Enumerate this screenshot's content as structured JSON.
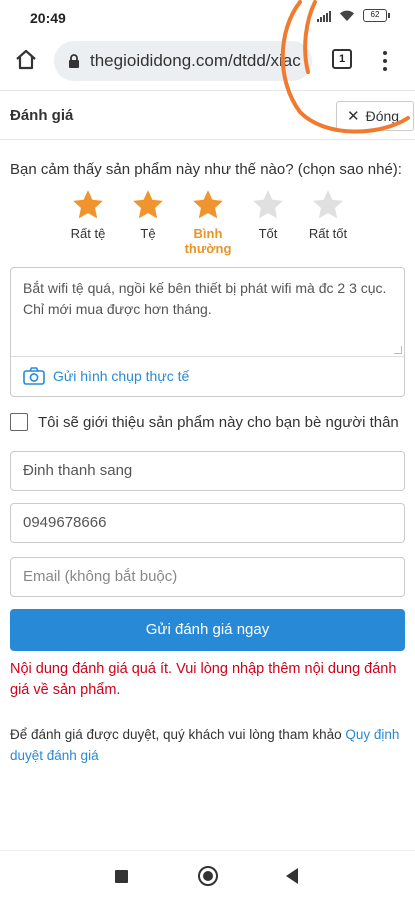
{
  "status": {
    "time": "20:49",
    "battery": "62"
  },
  "browser": {
    "url": "thegioididong.com/dtdd/xiac",
    "tab_count": "1"
  },
  "header": {
    "title": "Đánh giá",
    "close_label": "Đóng"
  },
  "rating": {
    "question": "Bạn cảm thấy sản phẩm này như thế nào? (chọn sao nhé):",
    "selected": 3,
    "star_color_active": "#f0952d",
    "star_color_inactive": "#e0e0e0",
    "options": [
      {
        "label": "Rất tệ"
      },
      {
        "label": "Tệ"
      },
      {
        "label": "Bình thường"
      },
      {
        "label": "Tốt"
      },
      {
        "label": "Rất tốt"
      }
    ]
  },
  "review": {
    "text": "Bắt wifi tệ quá, ngồi kế bên thiết bị phát wifi mà đc 2 3 cục. Chỉ mới mua được hơn tháng.",
    "photo_label": "Gửi hình chụp thực tế"
  },
  "recommend": {
    "label": "Tôi sẽ giới thiệu sản phẩm này cho bạn bè người thân",
    "checked": false
  },
  "form": {
    "name": "Đinh thanh sang",
    "phone": "0949678666",
    "email_placeholder": "Email (không bắt buộc)"
  },
  "submit_label": "Gửi đánh giá ngay",
  "error_message": "Nội dung đánh giá quá ít. Vui lòng nhập thêm nội dung đánh giá về sản phẩm.",
  "note": {
    "text": "Để đánh giá được duyệt, quý khách vui lòng tham khảo ",
    "link": "Quy định duyệt đánh giá"
  },
  "colors": {
    "accent": "#288ad6",
    "error": "#d0021b",
    "annotation": "#f07a30"
  }
}
